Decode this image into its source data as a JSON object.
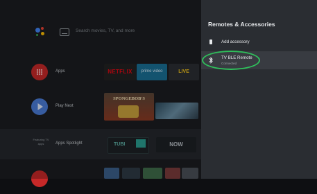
{
  "search": {
    "placeholder": "Search movies, TV, and more"
  },
  "rows": [
    {
      "label": "Apps"
    },
    {
      "label": "Play Next"
    },
    {
      "label": "Apps Spotlight",
      "sub": "Featuring TV apps"
    }
  ],
  "apps": {
    "netflix": "NETFLIX",
    "prime": "prime video",
    "live": "LIVE",
    "spongebob": "SPONGEBOB'S",
    "tubi": "TUBI",
    "now": "NOW"
  },
  "panel": {
    "title": "Remotes & Accessories",
    "add_label": "Add accessory",
    "device_label": "TV BLE Remote",
    "device_status": "Connected"
  },
  "colors": {
    "highlight_ring": "#2fbf5b",
    "apps_icon": "#c62828",
    "play_next_icon": "#4a7bd6"
  }
}
